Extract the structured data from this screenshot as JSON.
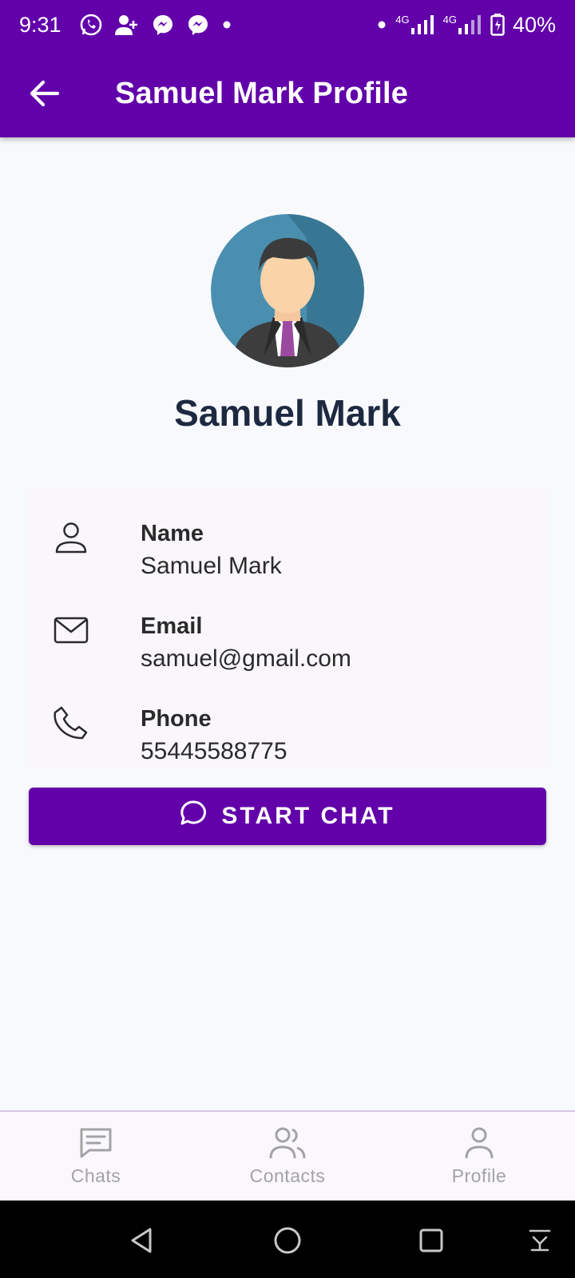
{
  "status_bar": {
    "time": "9:31",
    "network_1": "4G",
    "network_2": "4G",
    "battery": "40%",
    "icons": [
      "whatsapp-icon",
      "person-add-icon",
      "messenger-icon",
      "messenger-icon",
      "dot-icon"
    ]
  },
  "app_bar": {
    "title": "Samuel Mark Profile",
    "back_icon": "arrow-left-icon"
  },
  "profile": {
    "name": "Samuel Mark"
  },
  "details": [
    {
      "label": "Name",
      "value": "Samuel Mark",
      "icon": "person-icon"
    },
    {
      "label": "Email",
      "value": "samuel@gmail.com",
      "icon": "mail-icon"
    },
    {
      "label": "Phone",
      "value": "55445588775",
      "icon": "phone-icon"
    }
  ],
  "actions": {
    "start_chat_label": "START CHAT",
    "start_chat_icon": "chat-bubble-icon"
  },
  "bottom_nav": {
    "items": [
      {
        "label": "Chats",
        "icon": "chat-icon"
      },
      {
        "label": "Contacts",
        "icon": "contacts-icon"
      },
      {
        "label": "Profile",
        "icon": "profile-icon"
      }
    ]
  },
  "colors": {
    "primary": "#6200aa",
    "background": "#f8f9fc",
    "name_text": "#1d2940",
    "nav_inactive": "#a3a3a3"
  }
}
